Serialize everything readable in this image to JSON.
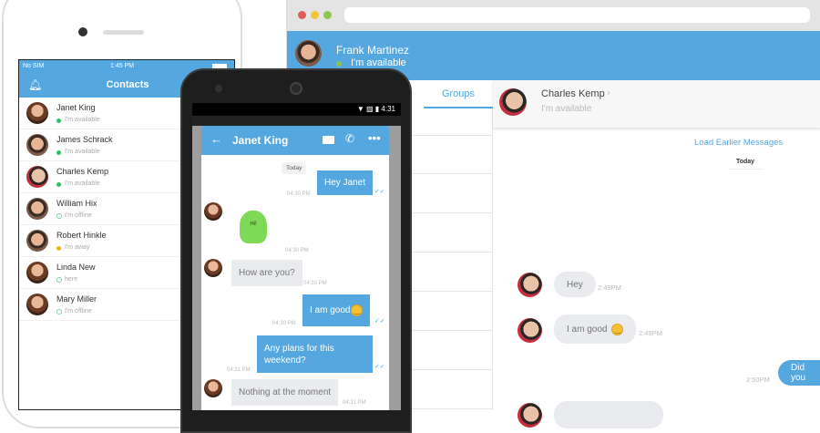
{
  "web": {
    "me": {
      "name": "Frank Martinez",
      "status": "I'm available"
    },
    "tabs": {
      "groups": "Groups"
    },
    "chat": {
      "name": "Charles Kemp",
      "status": "I'm available",
      "load_earlier": "Load Earlier Messages",
      "date": "Today",
      "messages": [
        {
          "text": "Hey",
          "time": "2:49PM",
          "dir": "in"
        },
        {
          "text": "I am good",
          "time": "2:49PM",
          "dir": "in",
          "emoji": "smile"
        },
        {
          "text": "Did you",
          "time": "2:50PM",
          "dir": "out"
        }
      ]
    }
  },
  "iphone": {
    "status": {
      "carrier": "No SIM",
      "time": "1:45 PM"
    },
    "title": "Contacts",
    "contacts": [
      {
        "name": "Janet King",
        "status": "I'm available",
        "state": "online"
      },
      {
        "name": "James Schrack",
        "status": "I'm available",
        "state": "online"
      },
      {
        "name": "Charles Kemp",
        "status": "I'm available",
        "state": "online"
      },
      {
        "name": "William Hix",
        "status": "I'm offline",
        "state": "offline"
      },
      {
        "name": "Robert Hinkle",
        "status": "I'm away",
        "state": "away"
      },
      {
        "name": "Linda New",
        "status": "here",
        "state": "offline"
      },
      {
        "name": "Mary Miller",
        "status": "I'm offline",
        "state": "offline"
      }
    ]
  },
  "android": {
    "status": {
      "time": "4:31"
    },
    "chat": {
      "name": "Janet King",
      "date": "Today",
      "messages": [
        {
          "text": "Hey Janet",
          "time": "04:30 PM",
          "dir": "out"
        },
        {
          "text": "",
          "time": "04:30 PM",
          "dir": "in",
          "sticker": "Hi!"
        },
        {
          "text": "How are you?",
          "time": "04:30 PM",
          "dir": "in"
        },
        {
          "text": "I am good",
          "time": "04:30 PM",
          "dir": "out",
          "emoji": "smile"
        },
        {
          "text": "Any plans for this weekend?",
          "time": "04:31 PM",
          "dir": "out"
        },
        {
          "text": "Nothing at the moment",
          "time": "04:31 PM",
          "dir": "in"
        }
      ]
    }
  },
  "colors": {
    "accent": "#55a7e0",
    "online": "#2ebd6b",
    "away": "#f0b323",
    "offline": "#7fcfa8"
  }
}
